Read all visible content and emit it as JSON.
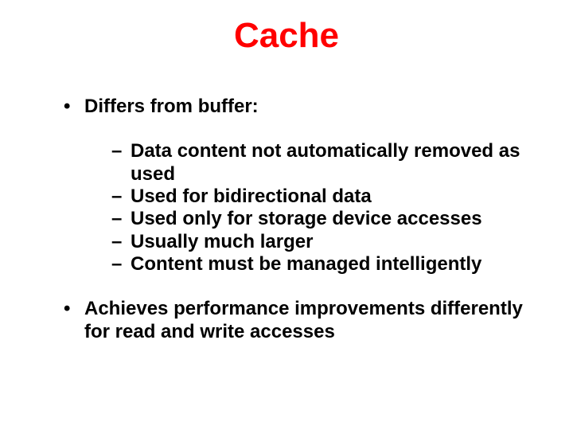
{
  "title": "Cache",
  "bullets": [
    {
      "text": "Differs from buffer:"
    },
    {
      "text": "Achieves performance improvements differently for read and write accesses"
    }
  ],
  "subbullets": [
    {
      "text": "Data content not automatically removed as used"
    },
    {
      "text": "Used for bidirectional data"
    },
    {
      "text": "Used only for storage device accesses"
    },
    {
      "text": "Usually much larger"
    },
    {
      "text": "Content must be managed intelligently"
    }
  ]
}
